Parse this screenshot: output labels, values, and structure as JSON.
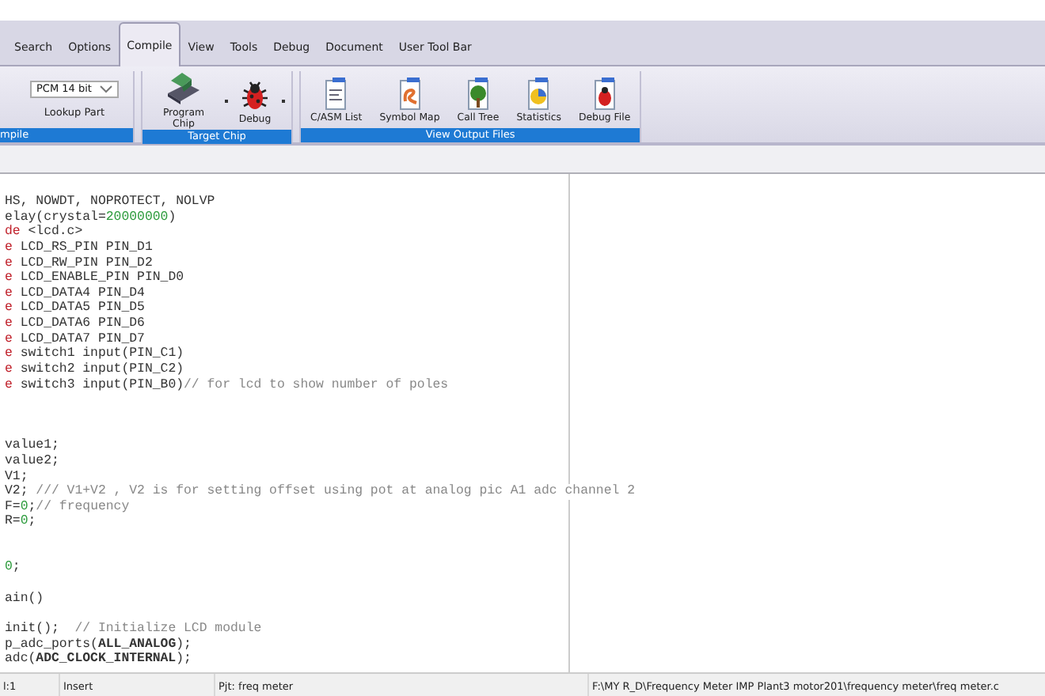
{
  "menu_tabs": [
    {
      "label": "Search",
      "selected": false
    },
    {
      "label": "Options",
      "selected": false
    },
    {
      "label": "Compile",
      "selected": true
    },
    {
      "label": "View",
      "selected": false
    },
    {
      "label": "Tools",
      "selected": false
    },
    {
      "label": "Debug",
      "selected": false
    },
    {
      "label": "Document",
      "selected": false
    },
    {
      "label": "User Tool Bar",
      "selected": false
    }
  ],
  "ribbon_groups": [
    {
      "title": "mpile",
      "items": [
        {
          "kind": "dropdown",
          "value": "PCM 14 bit",
          "label": "Lookup Part"
        }
      ]
    },
    {
      "title": "Target Chip",
      "items": [
        {
          "kind": "tool",
          "label": "Program Chip",
          "menu": true
        },
        {
          "kind": "tool",
          "label": "Debug",
          "menu": true
        }
      ]
    },
    {
      "title": "View Output Files",
      "items": [
        {
          "kind": "tool",
          "label": "C/ASM List",
          "menu": false
        },
        {
          "kind": "tool",
          "label": "Symbol Map",
          "menu": false
        },
        {
          "kind": "tool",
          "label": "Call Tree",
          "menu": false
        },
        {
          "kind": "tool",
          "label": "Statistics",
          "menu": false
        },
        {
          "kind": "tool",
          "label": "Debug File",
          "menu": false
        }
      ]
    }
  ],
  "code_lines": [
    {
      "kind": "code",
      "segments": [
        {
          "kind": "plain",
          "text": "HS, NOWDT, NOPROTECT, NOLVP"
        }
      ]
    },
    {
      "kind": "code",
      "segments": [
        {
          "kind": "plain",
          "text": "elay(crystal="
        },
        {
          "kind": "number",
          "text": "20000000"
        },
        {
          "kind": "plain",
          "text": ")"
        }
      ]
    },
    {
      "kind": "code",
      "segments": [
        {
          "kind": "keyword",
          "text": "de"
        },
        {
          "kind": "plain",
          "text": " <lcd.c>"
        }
      ]
    },
    {
      "kind": "code",
      "segments": [
        {
          "kind": "keyword",
          "text": "e"
        },
        {
          "kind": "plain",
          "text": " LCD_RS_PIN PIN_D1"
        }
      ]
    },
    {
      "kind": "code",
      "segments": [
        {
          "kind": "keyword",
          "text": "e"
        },
        {
          "kind": "plain",
          "text": " LCD_RW_PIN PIN_D2"
        }
      ]
    },
    {
      "kind": "code",
      "segments": [
        {
          "kind": "keyword",
          "text": "e"
        },
        {
          "kind": "plain",
          "text": " LCD_ENABLE_PIN PIN_D0"
        }
      ]
    },
    {
      "kind": "code",
      "segments": [
        {
          "kind": "keyword",
          "text": "e"
        },
        {
          "kind": "plain",
          "text": " LCD_DATA4 PIN_D4"
        }
      ]
    },
    {
      "kind": "code",
      "segments": [
        {
          "kind": "keyword",
          "text": "e"
        },
        {
          "kind": "plain",
          "text": " LCD_DATA5 PIN_D5"
        }
      ]
    },
    {
      "kind": "code",
      "segments": [
        {
          "kind": "keyword",
          "text": "e"
        },
        {
          "kind": "plain",
          "text": " LCD_DATA6 PIN_D6"
        }
      ]
    },
    {
      "kind": "code",
      "segments": [
        {
          "kind": "keyword",
          "text": "e"
        },
        {
          "kind": "plain",
          "text": " LCD_DATA7 PIN_D7"
        }
      ]
    },
    {
      "kind": "code",
      "segments": [
        {
          "kind": "keyword",
          "text": "e"
        },
        {
          "kind": "plain",
          "text": " switch1 input(PIN_C1)"
        }
      ]
    },
    {
      "kind": "code",
      "segments": [
        {
          "kind": "keyword",
          "text": "e"
        },
        {
          "kind": "plain",
          "text": " switch2 input(PIN_C2)"
        }
      ]
    },
    {
      "kind": "code",
      "segments": [
        {
          "kind": "keyword",
          "text": "e"
        },
        {
          "kind": "plain",
          "text": " switch3 input(PIN_B0)"
        },
        {
          "kind": "comment",
          "text": "// for lcd to show number of poles"
        }
      ]
    },
    {
      "kind": "blank"
    },
    {
      "kind": "blank"
    },
    {
      "kind": "blank"
    },
    {
      "kind": "code",
      "segments": [
        {
          "kind": "plain",
          "text": "value1;"
        }
      ]
    },
    {
      "kind": "code",
      "segments": [
        {
          "kind": "plain",
          "text": "value2;"
        }
      ]
    },
    {
      "kind": "code",
      "segments": [
        {
          "kind": "plain",
          "text": "V1;"
        }
      ]
    },
    {
      "kind": "code",
      "segments": [
        {
          "kind": "plain",
          "text": "V2; "
        },
        {
          "kind": "comment",
          "text": "/// V1+V2 , V2 is for setting offset using pot at analog pic A1 adc channel 2"
        }
      ]
    },
    {
      "kind": "code",
      "segments": [
        {
          "kind": "plain",
          "text": "F="
        },
        {
          "kind": "number",
          "text": "0"
        },
        {
          "kind": "plain",
          "text": ";"
        },
        {
          "kind": "comment",
          "text": "// frequency"
        }
      ]
    },
    {
      "kind": "code",
      "segments": [
        {
          "kind": "plain",
          "text": "R="
        },
        {
          "kind": "number",
          "text": "0"
        },
        {
          "kind": "plain",
          "text": ";"
        }
      ]
    },
    {
      "kind": "blank"
    },
    {
      "kind": "blank"
    },
    {
      "kind": "code",
      "segments": [
        {
          "kind": "number",
          "text": "0"
        },
        {
          "kind": "plain",
          "text": ";"
        }
      ]
    },
    {
      "kind": "blank"
    },
    {
      "kind": "code",
      "segments": [
        {
          "kind": "plain",
          "text": "ain()"
        }
      ]
    },
    {
      "kind": "blank"
    },
    {
      "kind": "code",
      "segments": [
        {
          "kind": "plain",
          "text": "init();  "
        },
        {
          "kind": "comment",
          "text": "// Initialize LCD module"
        }
      ]
    },
    {
      "kind": "code",
      "segments": [
        {
          "kind": "plain",
          "text": "p_adc_ports("
        },
        {
          "kind": "constant",
          "text": "ALL_ANALOG"
        },
        {
          "kind": "plain",
          "text": ");"
        }
      ]
    },
    {
      "kind": "code",
      "segments": [
        {
          "kind": "plain",
          "text": "adc("
        },
        {
          "kind": "constant",
          "text": "ADC_CLOCK_INTERNAL"
        },
        {
          "kind": "plain",
          "text": ");"
        }
      ]
    }
  ],
  "status_bar": {
    "position": "l:1",
    "mode": "Insert",
    "project": "Pjt: freq meter",
    "path": "F:\\MY R_D\\Frequency Meter IMP Plant3 motor201\\frequency meter\\freq meter.c"
  }
}
